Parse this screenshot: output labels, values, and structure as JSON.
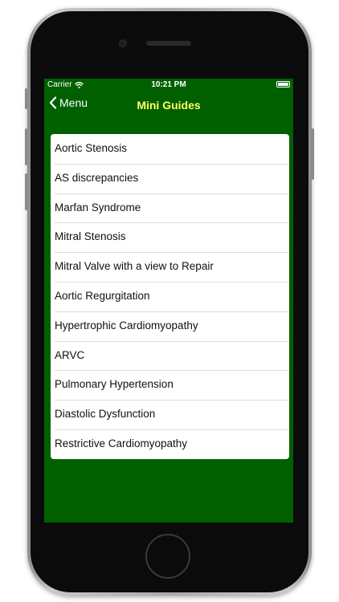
{
  "status_bar": {
    "carrier": "Carrier",
    "time": "10:21 PM"
  },
  "nav": {
    "back_label": "Menu",
    "title": "Mini Guides"
  },
  "guides": [
    "Aortic Stenosis",
    "AS discrepancies",
    "Marfan Syndrome",
    "Mitral Stenosis",
    "Mitral Valve with a view to Repair",
    "Aortic Regurgitation",
    "Hypertrophic Cardiomyopathy",
    "ARVC",
    "Pulmonary Hypertension",
    "Diastolic Dysfunction",
    "Restrictive Cardiomyopathy"
  ],
  "colors": {
    "background": "#006000",
    "title": "#ffff66",
    "list_bg": "#ffffff"
  },
  "icons": {
    "back": "chevron-left-icon",
    "wifi": "wifi-icon",
    "battery": "battery-icon"
  }
}
